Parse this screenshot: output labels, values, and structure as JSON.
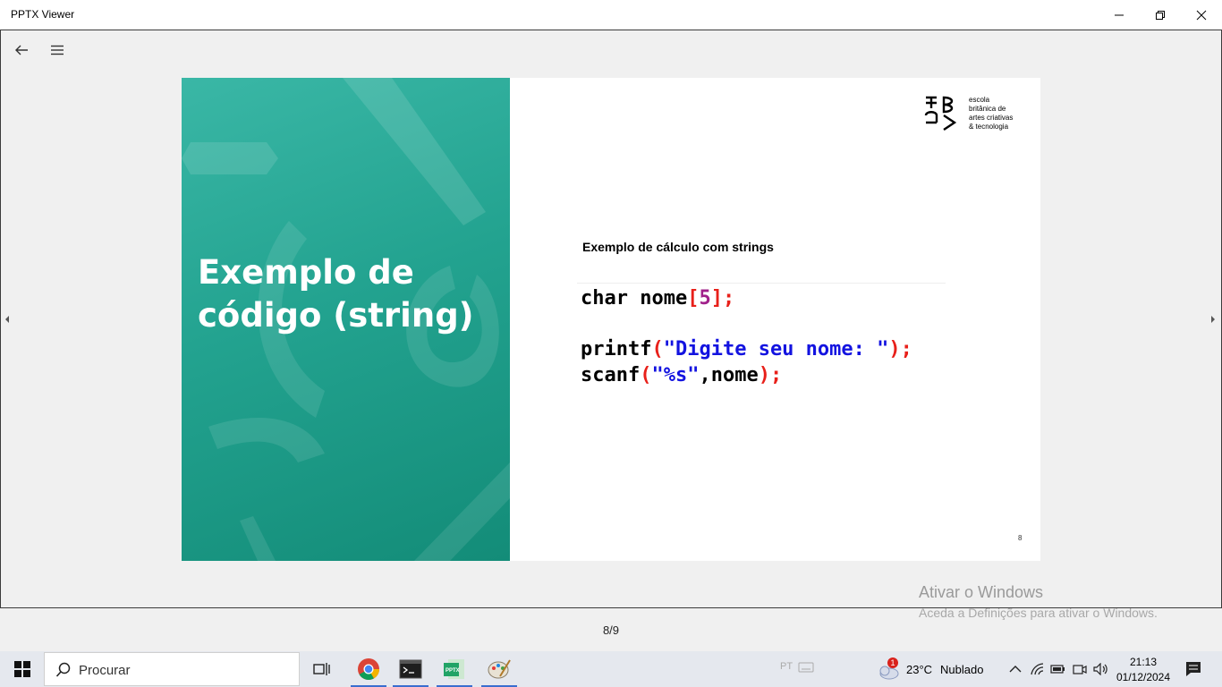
{
  "window": {
    "title": "PPTX Viewer"
  },
  "slide": {
    "title_line1": "Exemplo de",
    "title_line2": "código (string)",
    "subtitle": "Exemplo de cálculo com strings",
    "logo_text": [
      "escola",
      "britânica de",
      "artes criativas",
      "& tecnologia"
    ],
    "page_number": "8",
    "code": {
      "line1": [
        {
          "t": "char",
          "c": "#000000"
        },
        {
          "t": " nome",
          "c": "#000000"
        },
        {
          "t": "[",
          "c": "#e8201a"
        },
        {
          "t": "5",
          "c": "#a0208a"
        },
        {
          "t": "];",
          "c": "#e8201a"
        }
      ],
      "line2": [
        {
          "t": "printf",
          "c": "#000000"
        },
        {
          "t": "(",
          "c": "#e8201a"
        },
        {
          "t": "\"Digite seu nome: \"",
          "c": "#1313e0"
        },
        {
          "t": ");",
          "c": "#e8201a"
        }
      ],
      "line3": [
        {
          "t": "scanf",
          "c": "#000000"
        },
        {
          "t": "(",
          "c": "#e8201a"
        },
        {
          "t": "\"%s\"",
          "c": "#1313e0"
        },
        {
          "t": ",nome",
          "c": "#000000"
        },
        {
          "t": ");",
          "c": "#e8201a"
        }
      ]
    }
  },
  "footer": {
    "slide_counter": "8/9"
  },
  "watermark": {
    "line1": "Ativar o Windows",
    "line2": "Aceda a Definições para ativar o Windows."
  },
  "taskbar": {
    "search_placeholder": "Procurar",
    "lang": "PT",
    "weather_temp": "23°C",
    "weather_desc": "Nublado",
    "weather_badge": "1",
    "time": "21:13",
    "date": "01/12/2024"
  },
  "colors": {
    "accent": "#23a390",
    "taskbar": "#e5e8ee"
  }
}
